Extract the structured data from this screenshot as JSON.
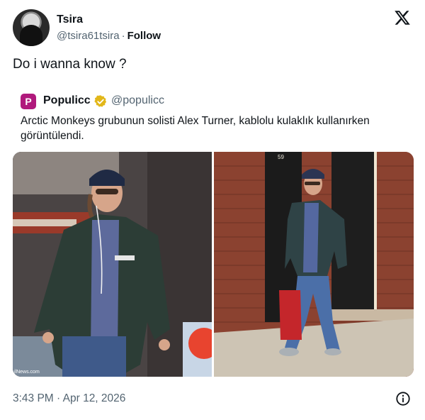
{
  "author": {
    "name": "Tsira",
    "handle": "@tsira61tsira",
    "separator": "·",
    "follow_label": "Follow"
  },
  "tweet": {
    "text": "Do i wanna know ?",
    "timestamp": "3:43 PM · Apr 12, 2026"
  },
  "quoted": {
    "avatar_letter": "P",
    "name": "Populicc",
    "handle": "@populicc",
    "text": "Arctic Monkeys grubunun solisti Alex Turner, kablolu kulaklık kullanırken görüntülendi."
  },
  "media": {
    "watermark": "ilNews.com",
    "door_number": "59"
  },
  "icons": {
    "logo": "x-logo-icon",
    "verified": "verified-badge-icon",
    "info": "info-icon"
  },
  "colors": {
    "primary_text": "#0f1419",
    "secondary_text": "#536471",
    "verified_gold": "#e2b719",
    "populicc_brand": "#b0197c"
  }
}
